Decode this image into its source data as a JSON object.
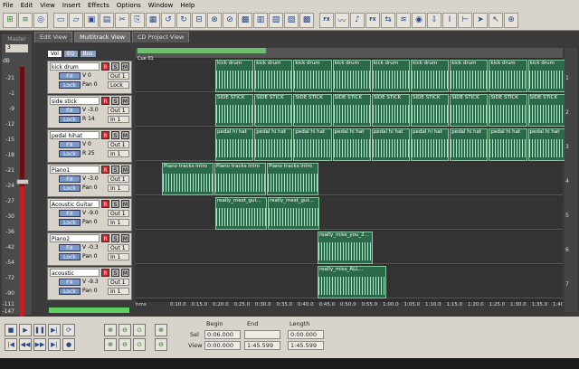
{
  "menu": [
    "File",
    "Edit",
    "View",
    "Insert",
    "Effects",
    "Options",
    "Window",
    "Help"
  ],
  "tabs": [
    "Edit View",
    "Multitrack View",
    "CD Project View"
  ],
  "master": {
    "label": "Master",
    "value": "3",
    "db": "dB",
    "scale": [
      "-21",
      "-1",
      "-9",
      "-12",
      "-15",
      "-18",
      "-21",
      "-24",
      "-27",
      "-30",
      "-36",
      "-42",
      "-54",
      "-72",
      "-90",
      "-111",
      "-147"
    ]
  },
  "trackhdr": [
    "Vol",
    "EQ",
    "Bus"
  ],
  "tracks": [
    {
      "name": "kick drum",
      "vol": "V 0",
      "pan": "Pan 0",
      "out": "Out 1",
      "in": "Lock"
    },
    {
      "name": "side stick",
      "vol": "V -3.0",
      "pan": "R 14",
      "out": "Out 1",
      "in": "In 1"
    },
    {
      "name": "pedal hihat",
      "vol": "V 0",
      "pan": "R 25",
      "out": "Out 1",
      "in": "In 1"
    },
    {
      "name": "Piano1",
      "vol": "V -3.0",
      "pan": "Pan 0",
      "out": "Out 1",
      "in": "In 1"
    },
    {
      "name": "Acoustic Guitar",
      "vol": "V -9.0",
      "pan": "Pan 0",
      "out": "Out 1",
      "in": "In 1"
    },
    {
      "name": "Piano2",
      "vol": "V -0.3",
      "pan": "Pan 0",
      "out": "Out 1",
      "in": "In 1"
    },
    {
      "name": "acoustic",
      "vol": "V -9.3",
      "pan": "Pan 0",
      "out": "Out 1",
      "in": "In 1"
    }
  ],
  "track_numbers": [
    "1",
    "2",
    "3",
    "4",
    "5",
    "6",
    "7"
  ],
  "cue": "Cue 01",
  "clips": {
    "kick": "kick drum",
    "side": "SIDE STICK",
    "hihat": "pedal hi hat",
    "piano1": "Piano tracks intro",
    "guitar": "really_mest_gut...",
    "piano2": "really_miss_you_2...",
    "acoustic": "really_miss_ALL..."
  },
  "ruler": [
    "hms",
    "0:10.0",
    "0:15.0",
    "0:20.0",
    "0:25.0",
    "0:30.0",
    "0:35.0",
    "0:40.0",
    "0:45.0",
    "0:50.0",
    "0:55.0",
    "1:00.0",
    "1:05.0",
    "1:10.0",
    "1:15.0",
    "1:20.0",
    "1:25.0",
    "1:30.0",
    "1:35.0",
    "1:40.0"
  ],
  "selview": {
    "begin": "Begin",
    "end": "End",
    "length": "Length",
    "sel": "Sel",
    "view": "View",
    "sel_begin": "0:06.000",
    "sel_end": "",
    "sel_length": "0:00.000",
    "view_begin": "0:00.000",
    "view_end": "1:45.599",
    "view_length": "1:45.599"
  }
}
